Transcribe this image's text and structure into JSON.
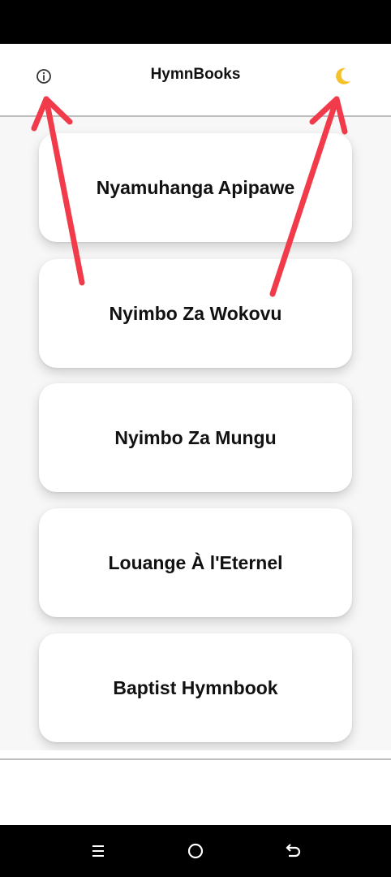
{
  "app_bar": {
    "title": "HymnBooks",
    "info_icon": "info-circle-icon",
    "theme_icon": "crescent-moon-icon",
    "theme_icon_color": "#f6c22b"
  },
  "hymnbooks": [
    {
      "label": "Nyamuhanga Apipawe"
    },
    {
      "label": "Nyimbo Za Wokovu"
    },
    {
      "label": "Nyimbo Za Mungu"
    },
    {
      "label": "Louange À l'Eternel"
    },
    {
      "label": "Baptist Hymnbook"
    }
  ],
  "nav_bar": {
    "menu_icon": "menu-lines-icon",
    "home_icon": "home-circle-icon",
    "back_icon": "back-arrow-icon"
  },
  "annotation": {
    "arrow_color": "#f23b4a"
  }
}
